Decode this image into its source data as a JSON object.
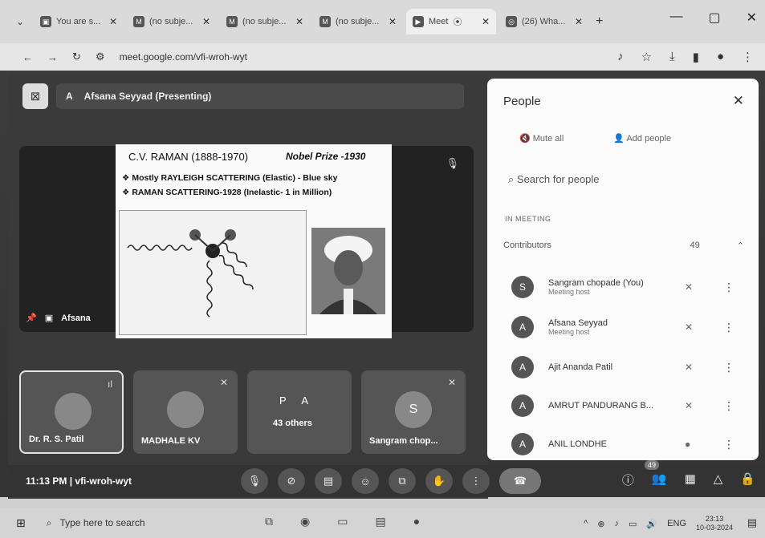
{
  "browser": {
    "tabs": [
      {
        "label": "You are s...",
        "icon": "app-icon"
      },
      {
        "label": "(no subje...",
        "icon": "gmail-icon"
      },
      {
        "label": "(no subje...",
        "icon": "gmail-icon"
      },
      {
        "label": "(no subje...",
        "icon": "gmail-icon"
      },
      {
        "label": "Meet",
        "icon": "meet-icon",
        "active": true
      },
      {
        "label": "(26) Wha...",
        "icon": "whatsapp-icon"
      }
    ],
    "url": "meet.google.com/vfi-wroh-wyt"
  },
  "meet": {
    "presenting_label": "Afsana Seyyad (Presenting)",
    "presenter_tile_name": "Afsana",
    "slide": {
      "title": "C.V. RAMAN  (1888-1970)",
      "nobel": "Nobel Prize -1930",
      "bullet1": "❖ Mostly  RAYLEIGH SCATTERING (Elastic) - Blue sky",
      "bullet2": "❖ RAMAN SCATTERING-1928  (Inelastic- 1 in  Million)"
    },
    "tiles": [
      {
        "name": "Dr. R. S. Patil",
        "avatar": ""
      },
      {
        "name": "MADHALE KV",
        "avatar": ""
      },
      {
        "initials": "P  A",
        "name": "43 others"
      },
      {
        "name": "Sangram chop...",
        "avatar": "S"
      }
    ],
    "time_code": "11:13 PM  |  vfi-wroh-wyt",
    "participant_badge": "49"
  },
  "people": {
    "title": "People",
    "mute_all": "Mute all",
    "add_people": "Add people",
    "search_placeholder": "Search for people",
    "section": "IN MEETING",
    "contributors_label": "Contributors",
    "contributors_count": "49",
    "list": [
      {
        "initial": "S",
        "name": "Sangram chopade (You)",
        "sub": "Meeting host"
      },
      {
        "initial": "A",
        "name": "Afsana Seyyad",
        "sub": "Meeting host"
      },
      {
        "initial": "A",
        "name": "Ajit Ananda Patil",
        "sub": ""
      },
      {
        "initial": "A",
        "name": "AMRUT PANDURANG B...",
        "sub": ""
      },
      {
        "initial": "A",
        "name": "ANIL LONDHE",
        "sub": ""
      }
    ]
  },
  "taskbar": {
    "search": "Type here to search",
    "lang": "ENG",
    "time": "23:13",
    "date": "10-03-2024"
  }
}
